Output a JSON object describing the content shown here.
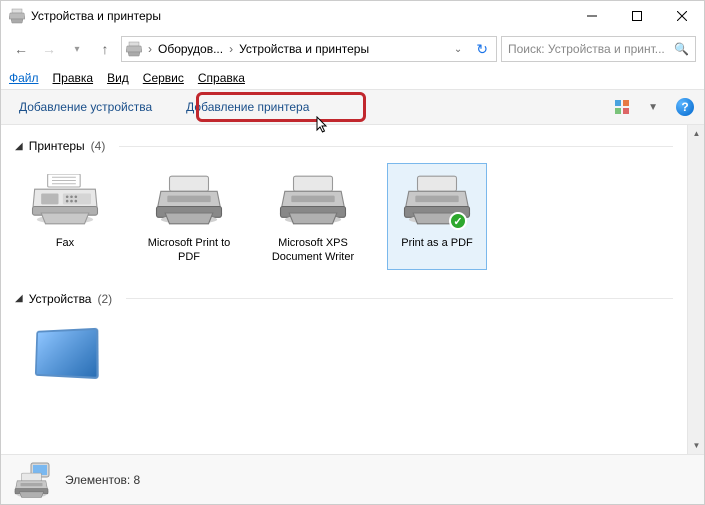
{
  "window": {
    "title": "Устройства и принтеры"
  },
  "nav": {
    "crumb1": "Оборудов...",
    "crumb2": "Устройства и принтеры"
  },
  "search": {
    "placeholder": "Поиск: Устройства и принт..."
  },
  "menu": {
    "file": "Файл",
    "edit": "Правка",
    "view": "Вид",
    "tools": "Сервис",
    "help": "Справка"
  },
  "toolbar": {
    "add_device": "Добавление устройства",
    "add_printer": "Добавление принтера"
  },
  "groups": {
    "printers": {
      "title": "Принтеры",
      "count": "(4)"
    },
    "devices": {
      "title": "Устройства",
      "count": "(2)"
    }
  },
  "printers": [
    {
      "label": "Fax"
    },
    {
      "label": "Microsoft Print to PDF"
    },
    {
      "label": "Microsoft XPS Document Writer"
    },
    {
      "label": "Print as a PDF"
    }
  ],
  "status": {
    "label": "Элементов:",
    "count": "8"
  }
}
